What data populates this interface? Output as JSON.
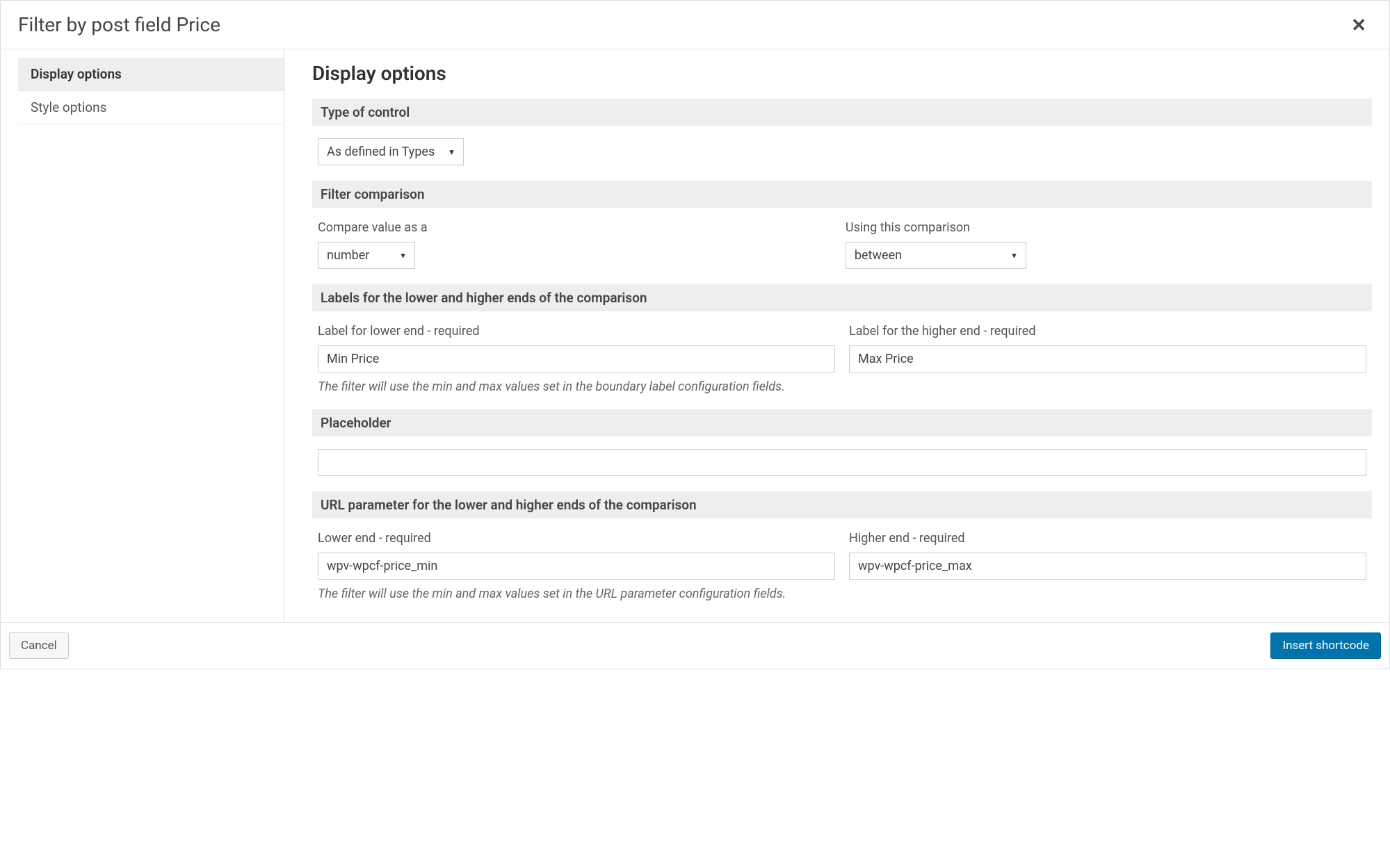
{
  "dialog": {
    "title": "Filter by post field Price"
  },
  "sidebar": {
    "items": [
      {
        "label": "Display options",
        "active": true
      },
      {
        "label": "Style options",
        "active": false
      }
    ]
  },
  "content": {
    "heading": "Display options",
    "sections": {
      "typeOfControl": {
        "title": "Type of control",
        "selectValue": "As defined in Types"
      },
      "filterComparison": {
        "title": "Filter comparison",
        "compareLabel": "Compare value as a",
        "compareValue": "number",
        "usingLabel": "Using this comparison",
        "usingValue": "between"
      },
      "labels": {
        "title": "Labels for the lower and higher ends of the comparison",
        "lowerLabel": "Label for lower end - required",
        "lowerValue": "Min Price",
        "higherLabel": "Label for the higher end - required",
        "higherValue": "Max Price",
        "help": "The filter will use the min and max values set in the boundary label configuration fields."
      },
      "placeholder": {
        "title": "Placeholder",
        "value": ""
      },
      "urlParam": {
        "title": "URL parameter for the lower and higher ends of the comparison",
        "lowerLabel": "Lower end - required",
        "lowerValue": "wpv-wpcf-price_min",
        "higherLabel": "Higher end - required",
        "higherValue": "wpv-wpcf-price_max",
        "help": "The filter will use the min and max values set in the URL parameter configuration fields."
      }
    }
  },
  "footer": {
    "cancel": "Cancel",
    "insert": "Insert shortcode"
  }
}
